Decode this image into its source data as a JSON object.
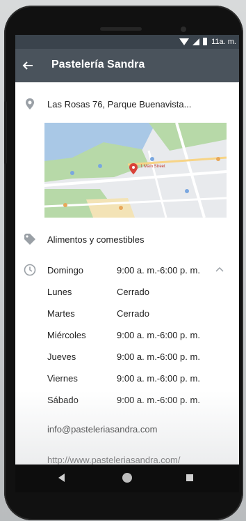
{
  "status_bar": {
    "time": "11a. m.",
    "icons": [
      "wifi-icon",
      "signal-icon",
      "battery-icon"
    ]
  },
  "app_bar": {
    "back_icon": "arrow-left-icon",
    "title": "Pastelería Sandra"
  },
  "place": {
    "address": "Las Rosas 76, Parque Buenavista...",
    "map_pin_label": "1 Main Street",
    "category": "Alimentos y comestibles",
    "hours": [
      {
        "day": "Domingo",
        "time": "9:00 a. m.-6:00 p. m."
      },
      {
        "day": "Lunes",
        "time": "Cerrado"
      },
      {
        "day": "Martes",
        "time": "Cerrado"
      },
      {
        "day": "Miércoles",
        "time": "9:00 a. m.-6:00 p. m."
      },
      {
        "day": "Jueves",
        "time": "9:00 a. m.-6:00 p. m."
      },
      {
        "day": "Viernes",
        "time": "9:00 a. m.-6:00 p. m."
      },
      {
        "day": "Sábado",
        "time": "9:00 a. m.-6:00 p. m."
      }
    ],
    "email": "info@pasteleriasandra.com",
    "website": "http://www.pasteleriasandra.com/"
  },
  "colors": {
    "status_bar": "#3a434c",
    "app_bar": "#4a535c",
    "icon_gray": "#9aa0a6",
    "map_pin": "#d9433a",
    "map_water": "#a9c8e6",
    "map_park": "#b7d9a8"
  },
  "icons": {
    "address": "location-pin-icon",
    "category": "tag-icon",
    "hours": "clock-icon",
    "hours_toggle": "chevron-up-icon"
  }
}
